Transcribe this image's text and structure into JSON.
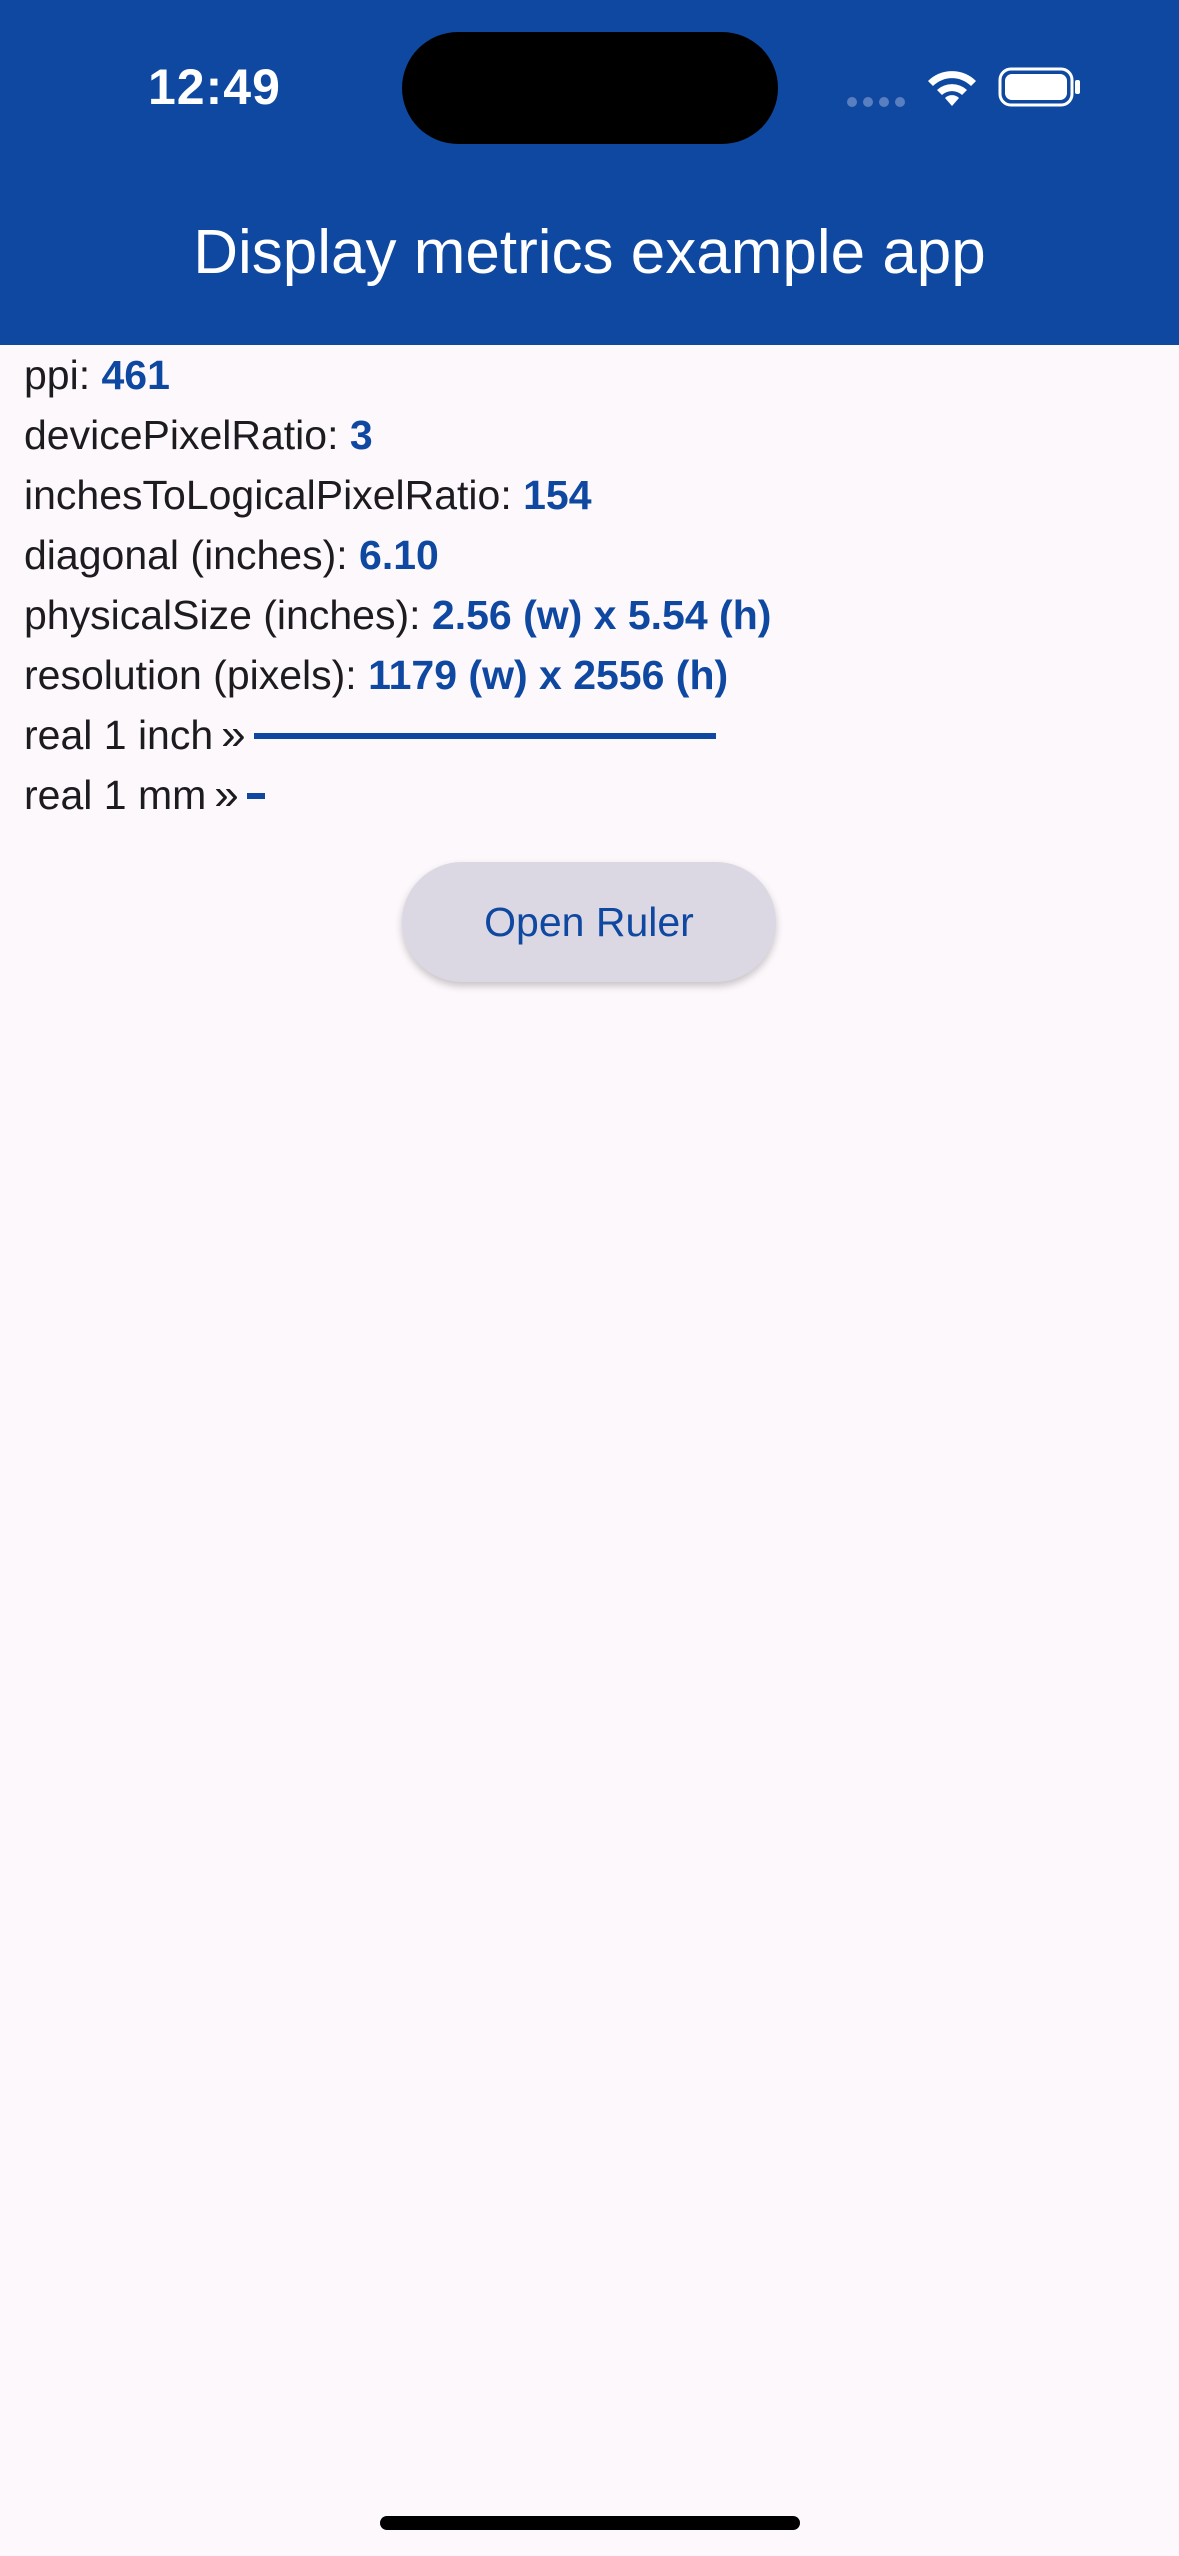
{
  "status_bar": {
    "time": "12:49"
  },
  "app_bar": {
    "title": "Display metrics example app"
  },
  "metrics": [
    {
      "label": "ppi: ",
      "value": "461"
    },
    {
      "label": "devicePixelRatio: ",
      "value": "3"
    },
    {
      "label": "inchesToLogicalPixelRatio: ",
      "value": "154"
    },
    {
      "label": "diagonal (inches): ",
      "value": "6.10"
    },
    {
      "label": "physicalSize (inches): ",
      "value": "2.56 (w) x 5.54 (h)"
    },
    {
      "label": "resolution (pixels): ",
      "value": "1179 (w) x 2556 (h)"
    }
  ],
  "rulers": {
    "inch_label": "real 1 inch",
    "mm_label": "real 1 mm",
    "chevron": "»"
  },
  "button": {
    "open_ruler_label": "Open Ruler"
  },
  "colors": {
    "app_bar_background": "#0f48a1",
    "accent": "#0f48a1",
    "page_background": "#fdf8fc",
    "button_background": "#dcd8e3"
  },
  "icons": [
    "signal-icon",
    "wifi-icon",
    "battery-icon"
  ]
}
